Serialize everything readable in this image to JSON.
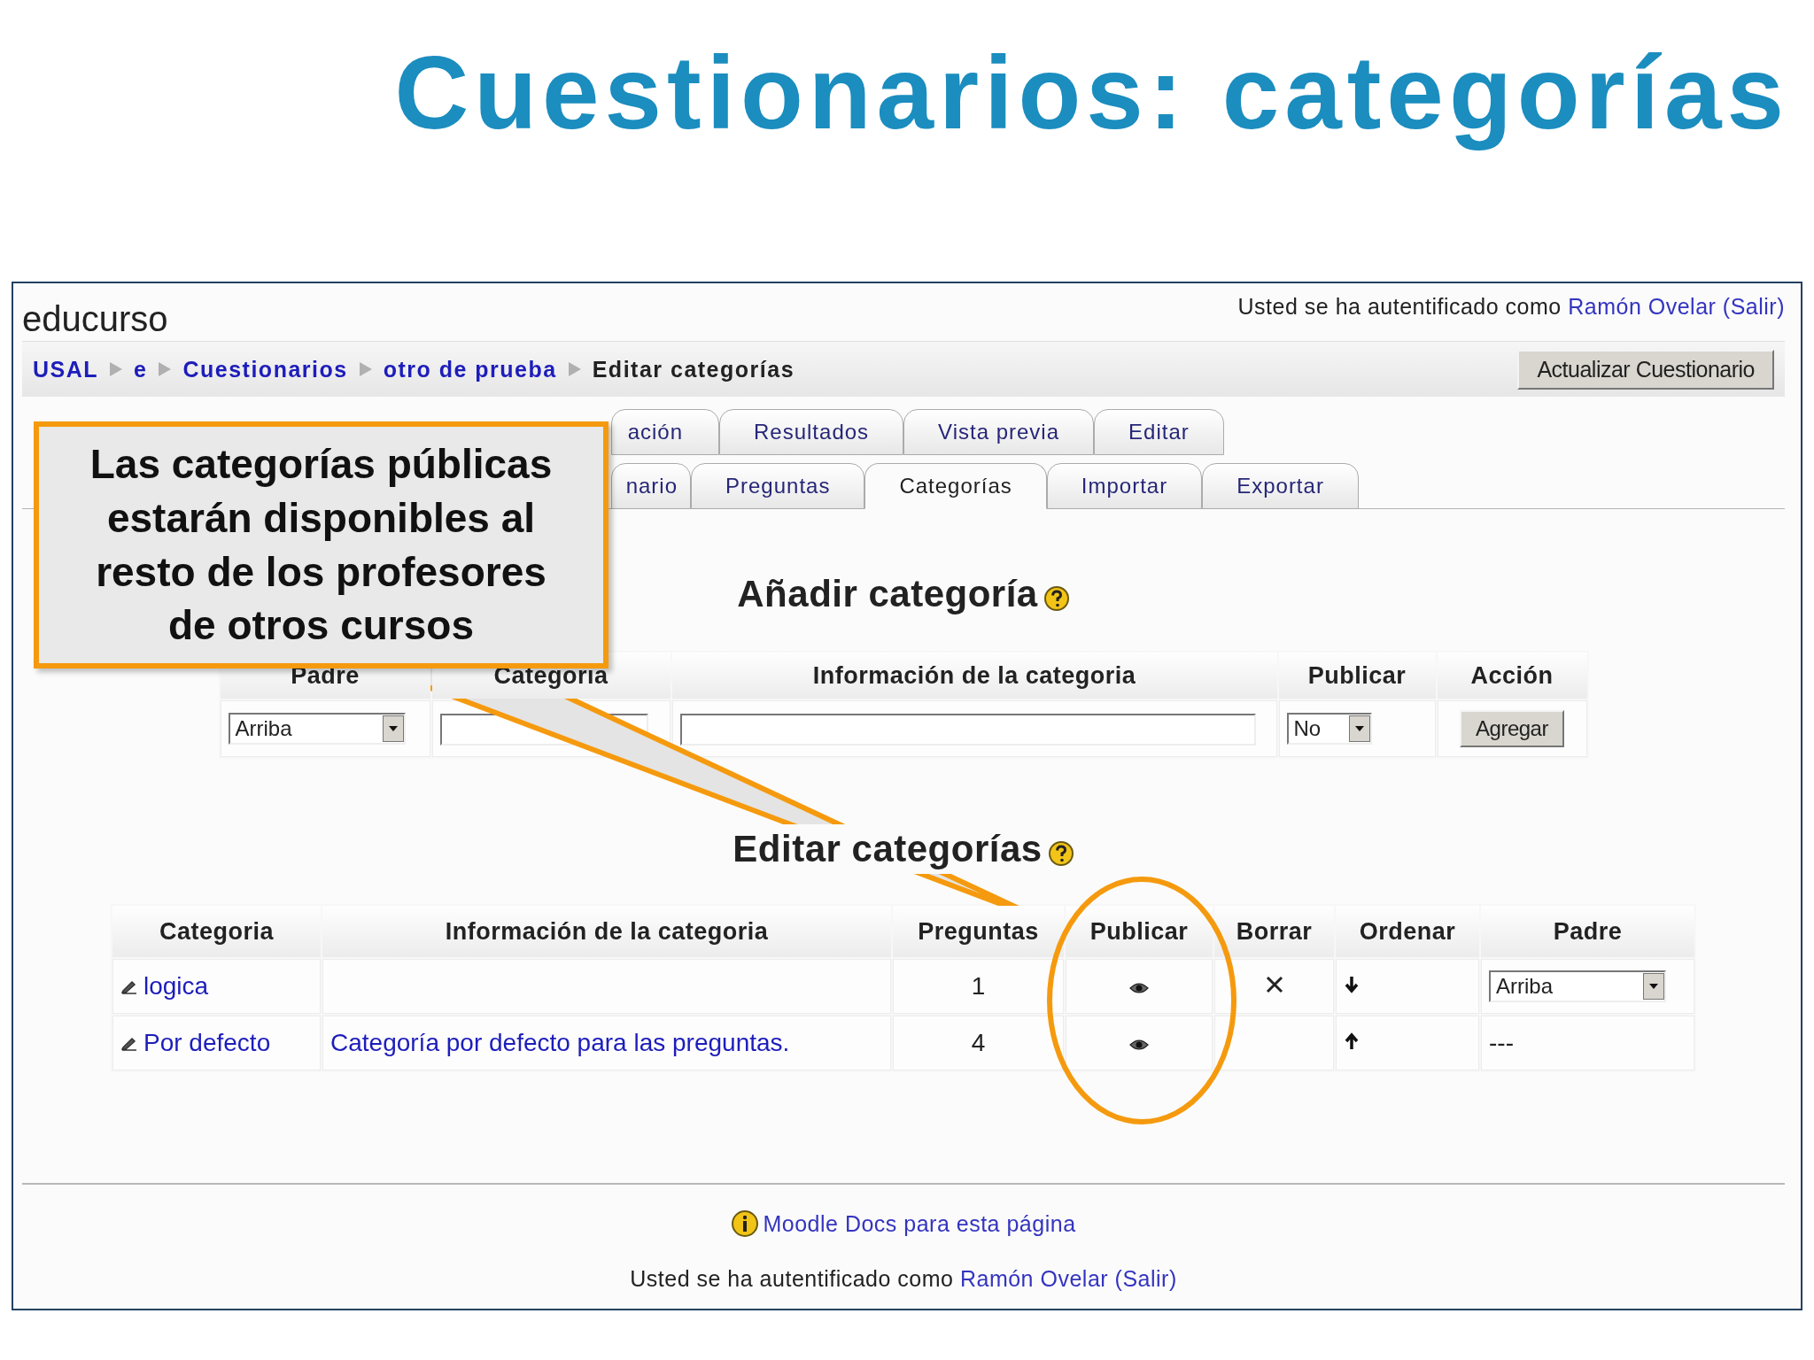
{
  "slide_title": "Cuestionarios: categorías",
  "header": {
    "site_name": "educurso",
    "login": {
      "prefix": "Usted se ha autentificado como",
      "user": "Ramón Ovelar",
      "logout": "(Salir)"
    }
  },
  "breadcrumb": [
    {
      "label": "USAL",
      "link": true
    },
    {
      "label": "e",
      "link": true
    },
    {
      "label": "Cuestionarios",
      "link": true
    },
    {
      "label": "otro de prueba",
      "link": true
    },
    {
      "label": "Editar categorías",
      "link": false
    }
  ],
  "update_button": "Actualizar Cuestionario",
  "tabs_row_1": [
    {
      "label": "ación",
      "selected": false
    },
    {
      "label": "Resultados",
      "selected": false
    },
    {
      "label": "Vista previa",
      "selected": false
    },
    {
      "label": "Editar",
      "selected": false
    }
  ],
  "tabs_row_2": [
    {
      "label": "nario",
      "selected": false
    },
    {
      "label": "Preguntas",
      "selected": false
    },
    {
      "label": "Categorías",
      "selected": true
    },
    {
      "label": "Importar",
      "selected": false
    },
    {
      "label": "Exportar",
      "selected": false
    }
  ],
  "add_section": {
    "title": "Añadir categoría",
    "columns": [
      "Padre",
      "Categoria",
      "Información de la categoria",
      "Publicar",
      "Acción"
    ],
    "parent_select": "Arriba",
    "publish_select": "No",
    "button": "Agregar"
  },
  "edit_section": {
    "title": "Editar categorías",
    "columns": [
      "Categoria",
      "Información de la categoria",
      "Preguntas",
      "Publicar",
      "Borrar",
      "Ordenar",
      "Padre"
    ],
    "rows": [
      {
        "name": "logica",
        "questions": "1",
        "published": true,
        "can_delete": true,
        "can_move_down": true,
        "can_move_up": false,
        "parent": {
          "kind": "select",
          "value": "Arriba"
        }
      },
      {
        "name": "Por defecto",
        "info": "Categoría por defecto para las preguntas.",
        "questions": "4",
        "published": true,
        "can_delete": false,
        "can_move_down": false,
        "can_move_up": true,
        "parent": {
          "kind": "text",
          "value": "---"
        }
      }
    ]
  },
  "footer": {
    "docs_link": "Moodle Docs para esta página",
    "login": {
      "prefix": "Usted se ha autentificado como",
      "user": "Ramón Ovelar",
      "logout": "(Salir)"
    }
  },
  "callout": {
    "lines": [
      "Las categorías públicas",
      "estarán disponibles al",
      "resto de los profesores",
      "de otros cursos"
    ]
  }
}
